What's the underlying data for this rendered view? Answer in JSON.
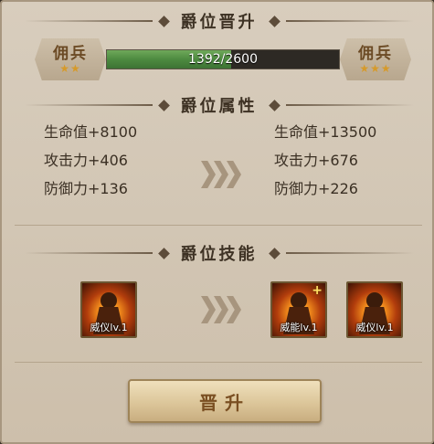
{
  "promotion": {
    "title": "爵位晋升",
    "current_rank": {
      "name": "佣兵",
      "stars": "★★"
    },
    "next_rank": {
      "name": "佣兵",
      "stars": "★★★"
    },
    "progress": {
      "text": "1392/2600",
      "current": 1392,
      "total": 2600
    }
  },
  "attributes": {
    "title": "爵位属性",
    "current": [
      "生命值+8100",
      "攻击力+406",
      "防御力+136"
    ],
    "next": [
      "生命值+13500",
      "攻击力+676",
      "防御力+226"
    ]
  },
  "skills": {
    "title": "爵位技能",
    "current": [
      {
        "label": "威仪lv.1",
        "icon": "flame-monk-icon"
      }
    ],
    "next": [
      {
        "label": "威能lv.1",
        "icon": "flame-monk-icon",
        "badge": "+"
      },
      {
        "label": "威仪lv.1",
        "icon": "flame-monk-icon"
      }
    ]
  },
  "actions": {
    "promote_label": "晋升"
  },
  "colors": {
    "progress_fill": "#4d8a40",
    "star": "#d69a2a",
    "title_text": "#3e3224"
  }
}
